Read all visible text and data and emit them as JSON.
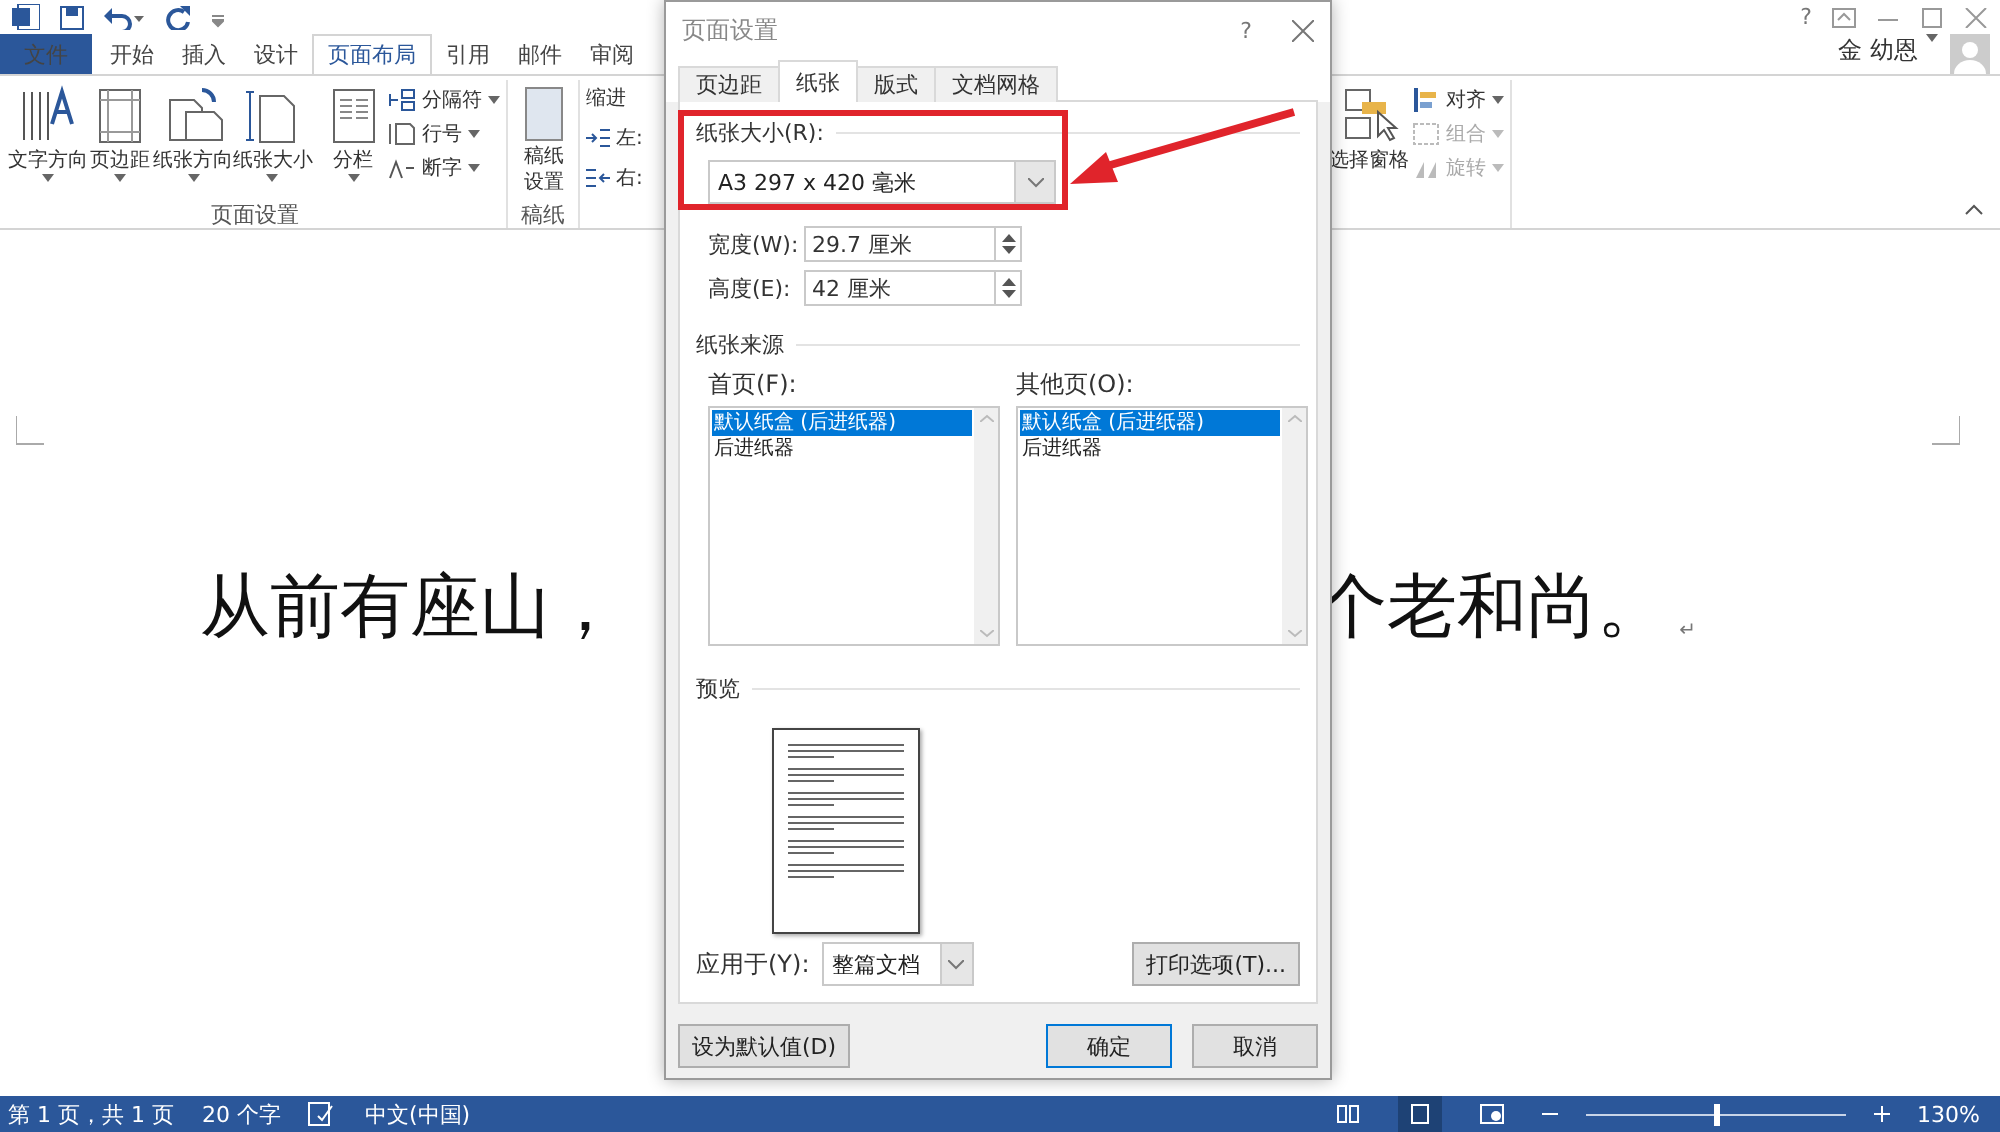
{
  "title_bar": {
    "help": "?"
  },
  "ribbon_tabs": [
    {
      "label": "文件",
      "kind": "file",
      "selected": false
    },
    {
      "label": "开始",
      "kind": "tab",
      "selected": false
    },
    {
      "label": "插入",
      "kind": "tab",
      "selected": false
    },
    {
      "label": "设计",
      "kind": "tab",
      "selected": false
    },
    {
      "label": "页面布局",
      "kind": "tab",
      "selected": true
    },
    {
      "label": "引用",
      "kind": "tab",
      "selected": false
    },
    {
      "label": "邮件",
      "kind": "tab",
      "selected": false
    },
    {
      "label": "审阅",
      "kind": "tab",
      "selected": false
    }
  ],
  "user_name": "金 幼恩",
  "page_setup_group": {
    "label": "页面设置",
    "large_buttons": [
      "文字方向",
      "页边距",
      "纸张方向",
      "纸张大小",
      "分栏"
    ],
    "small_buttons": [
      "分隔符",
      "行号",
      "断字"
    ]
  },
  "manuscript_group": {
    "button": "稿纸设置",
    "label": "稿纸"
  },
  "indent_group": {
    "title": "缩进",
    "left": "左:",
    "right": "右:"
  },
  "arrange_group": {
    "large_button": "选择窗格",
    "small_buttons": [
      {
        "label": "对齐",
        "disabled": false
      },
      {
        "label": "组合",
        "disabled": true
      },
      {
        "label": "旋转",
        "disabled": true
      }
    ]
  },
  "document": {
    "text_left": "从前有座山，",
    "text_right": "个老和尚。",
    "paragraph_mark": "↵"
  },
  "dialog": {
    "title": "页面设置",
    "help": "?",
    "tabs": [
      {
        "label": "页边距",
        "selected": false
      },
      {
        "label": "纸张",
        "selected": true
      },
      {
        "label": "版式",
        "selected": false
      },
      {
        "label": "文档网格",
        "selected": false
      }
    ],
    "paper_size": {
      "heading": "纸张大小(R):",
      "value": "A3 297 x 420 毫米"
    },
    "width": {
      "label": "宽度(W):",
      "value": "29.7 厘米"
    },
    "height": {
      "label": "高度(E):",
      "value": "42 厘米"
    },
    "paper_source": {
      "heading": "纸张来源",
      "lists": [
        {
          "label": "首页(F):",
          "items": [
            {
              "label": "默认纸盒 (后进纸器)",
              "selected": true
            },
            {
              "label": "后进纸器",
              "selected": false
            }
          ]
        },
        {
          "label": "其他页(O):",
          "items": [
            {
              "label": "默认纸盒 (后进纸器)",
              "selected": true
            },
            {
              "label": "后进纸器",
              "selected": false
            }
          ]
        }
      ]
    },
    "preview": {
      "heading": "预览"
    },
    "apply_to": {
      "label": "应用于(Y):",
      "value": "整篇文档"
    },
    "print_options": "打印选项(T)...",
    "buttons": [
      {
        "label": "设为默认值(D)",
        "kind": "default"
      },
      {
        "label": "确定",
        "kind": "primary"
      },
      {
        "label": "取消",
        "kind": "normal"
      }
    ]
  },
  "status_bar": {
    "page": "第 1 页，共 1 页",
    "words": "20 个字",
    "language": "中文(中国)",
    "views": [
      {
        "kind": "read",
        "selected": false
      },
      {
        "kind": "print",
        "selected": true
      },
      {
        "kind": "web",
        "selected": false
      }
    ],
    "zoom": {
      "level": 0.5,
      "reading": "130%"
    }
  }
}
